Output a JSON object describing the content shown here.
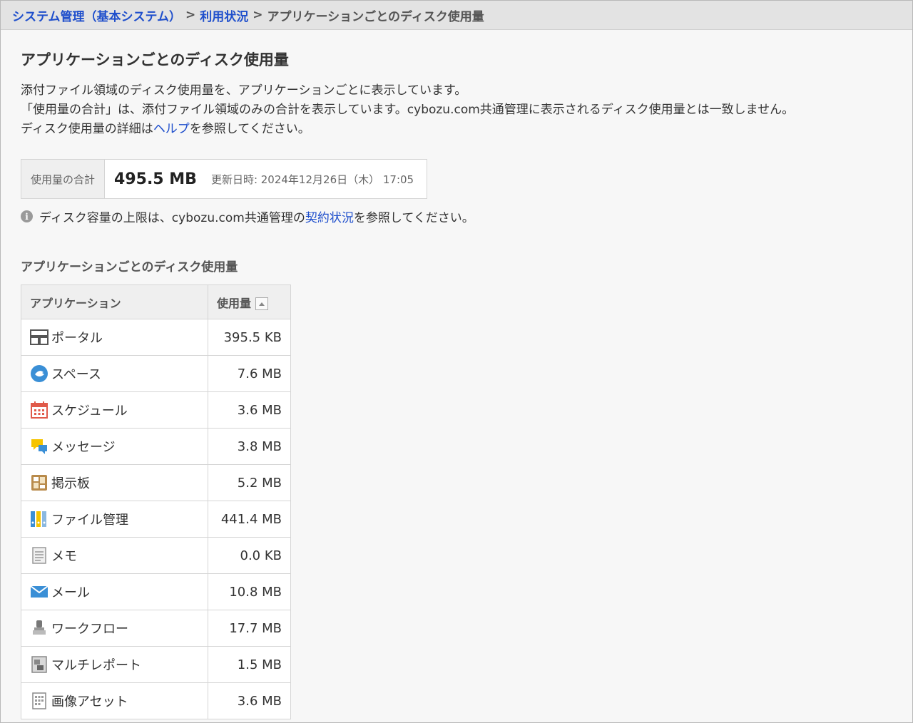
{
  "breadcrumb": {
    "item1": "システム管理（基本システム）",
    "sep1": ">",
    "item2": "利用状況",
    "sep2": ">",
    "current": "アプリケーションごとのディスク使用量"
  },
  "page_title": "アプリケーションごとのディスク使用量",
  "description": {
    "line1": "添付ファイル領域のディスク使用量を、アプリケーションごとに表示しています。",
    "line2": "「使用量の合計」は、添付ファイル領域のみの合計を表示しています。cybozu.com共通管理に表示されるディスク使用量とは一致しません。",
    "line3_before": "ディスク使用量の詳細は",
    "line3_link": "ヘルプ",
    "line3_after": "を参照してください。"
  },
  "usage": {
    "label": "使用量の合計",
    "amount": "495.5 MB",
    "updated": "更新日時: 2024年12月26日（木） 17:05"
  },
  "notice": {
    "before": "ディスク容量の上限は、cybozu.com共通管理の",
    "link": "契約状況",
    "after": "を参照してください。"
  },
  "section_title": "アプリケーションごとのディスク使用量",
  "table": {
    "col_app": "アプリケーション",
    "col_usage": "使用量",
    "rows": [
      {
        "name": "ポータル",
        "size": "395.5 KB",
        "icon": "portal-icon"
      },
      {
        "name": "スペース",
        "size": "7.6 MB",
        "icon": "space-icon"
      },
      {
        "name": "スケジュール",
        "size": "3.6 MB",
        "icon": "calendar-icon"
      },
      {
        "name": "メッセージ",
        "size": "3.8 MB",
        "icon": "message-icon"
      },
      {
        "name": "掲示板",
        "size": "5.2 MB",
        "icon": "bulletin-board-icon"
      },
      {
        "name": "ファイル管理",
        "size": "441.4 MB",
        "icon": "file-binders-icon"
      },
      {
        "name": "メモ",
        "size": "0.0 KB",
        "icon": "memo-icon"
      },
      {
        "name": "メール",
        "size": "10.8 MB",
        "icon": "mail-icon"
      },
      {
        "name": "ワークフロー",
        "size": "17.7 MB",
        "icon": "workflow-stamp-icon"
      },
      {
        "name": "マルチレポート",
        "size": "1.5 MB",
        "icon": "multireport-icon"
      },
      {
        "name": "画像アセット",
        "size": "3.6 MB",
        "icon": "image-asset-icon"
      }
    ]
  }
}
